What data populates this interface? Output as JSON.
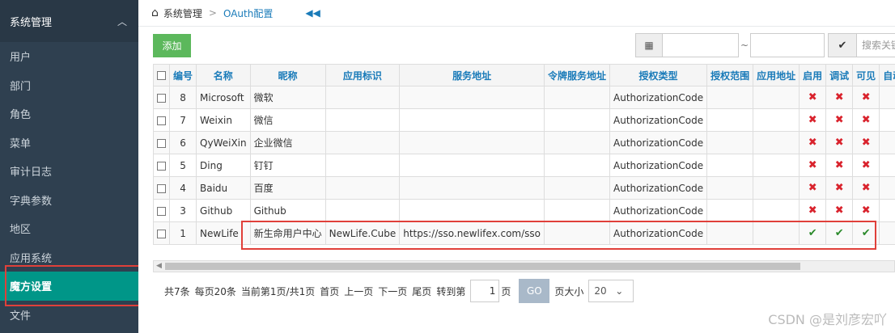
{
  "sidebar": {
    "header": "系统管理",
    "items": [
      {
        "label": "用户"
      },
      {
        "label": "部门"
      },
      {
        "label": "角色"
      },
      {
        "label": "菜单"
      },
      {
        "label": "审计日志"
      },
      {
        "label": "字典参数"
      },
      {
        "label": "地区"
      },
      {
        "label": "应用系统"
      },
      {
        "label": "魔方设置"
      },
      {
        "label": "文件"
      }
    ]
  },
  "breadcrumb": {
    "root": "系统管理",
    "current": "OAuth配置"
  },
  "toolbar": {
    "add_label": "添加",
    "date_sep": "~",
    "search_placeholder": "搜索关键"
  },
  "table": {
    "headers": [
      "编号",
      "名称",
      "昵称",
      "应用标识",
      "服务地址",
      "令牌服务地址",
      "授权类型",
      "授权范围",
      "应用地址",
      "启用",
      "调试",
      "可见",
      "自动注册",
      "自"
    ],
    "rows": [
      {
        "id": "8",
        "name": "Microsoft",
        "nick": "微软",
        "appid": "",
        "server": "",
        "token": "",
        "grant": "AuthorizationCode",
        "scope": "",
        "appurl": "",
        "flags": [
          false,
          false,
          false,
          false
        ]
      },
      {
        "id": "7",
        "name": "Weixin",
        "nick": "微信",
        "appid": "",
        "server": "",
        "token": "",
        "grant": "AuthorizationCode",
        "scope": "",
        "appurl": "",
        "flags": [
          false,
          false,
          false,
          false
        ]
      },
      {
        "id": "6",
        "name": "QyWeiXin",
        "nick": "企业微信",
        "appid": "",
        "server": "",
        "token": "",
        "grant": "AuthorizationCode",
        "scope": "",
        "appurl": "",
        "flags": [
          false,
          false,
          false,
          false
        ]
      },
      {
        "id": "5",
        "name": "Ding",
        "nick": "钉钉",
        "appid": "",
        "server": "",
        "token": "",
        "grant": "AuthorizationCode",
        "scope": "",
        "appurl": "",
        "flags": [
          false,
          false,
          false,
          false
        ]
      },
      {
        "id": "4",
        "name": "Baidu",
        "nick": "百度",
        "appid": "",
        "server": "",
        "token": "",
        "grant": "AuthorizationCode",
        "scope": "",
        "appurl": "",
        "flags": [
          false,
          false,
          false,
          false
        ]
      },
      {
        "id": "3",
        "name": "Github",
        "nick": "Github",
        "appid": "",
        "server": "",
        "token": "",
        "grant": "AuthorizationCode",
        "scope": "",
        "appurl": "",
        "flags": [
          false,
          false,
          false,
          false
        ]
      },
      {
        "id": "1",
        "name": "NewLife",
        "nick": "新生命用户中心",
        "appid": "NewLife.Cube",
        "server": "https://sso.newlifex.com/sso",
        "token": "",
        "grant": "AuthorizationCode",
        "scope": "",
        "appurl": "",
        "flags": [
          true,
          true,
          true,
          true
        ]
      }
    ]
  },
  "pager": {
    "total": "共7条",
    "per_page": "每页20条",
    "current": "当前第1页/共1页",
    "first": "首页",
    "prev": "上一页",
    "next": "下一页",
    "last": "尾页",
    "goto": "转到第",
    "page_value": "1",
    "page_unit": "页",
    "go_label": "GO",
    "size_label": "页大小",
    "size_value": "20"
  },
  "watermark": "CSDN @是刘彦宏吖",
  "colors": {
    "sidebar_bg": "#2f4050",
    "active": "#009688",
    "link": "#1a7bb9",
    "highlight": "#e0403a",
    "add": "#5cb85c"
  }
}
